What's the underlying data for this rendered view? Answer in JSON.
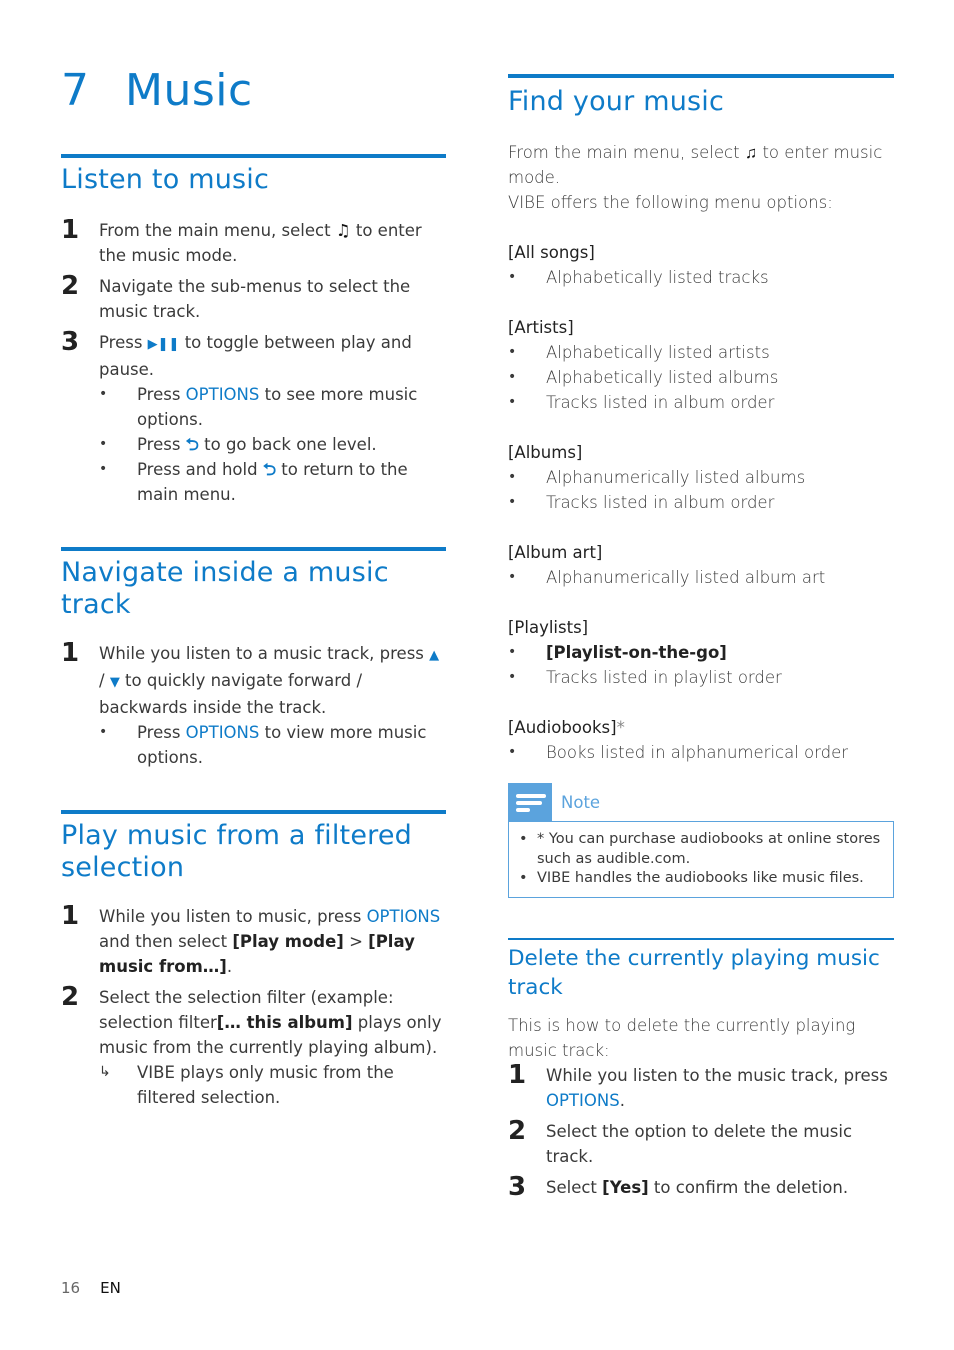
{
  "chapter": {
    "number": "7",
    "title": "Music"
  },
  "listen": {
    "title": "Listen to music",
    "steps": [
      {
        "n": "1",
        "before": "From the main menu, select ",
        "icon": "music-note-icon",
        "glyph": "♫",
        "after": " to enter the music mode."
      },
      {
        "n": "2",
        "text": "Navigate the sub-menus to select the music track."
      },
      {
        "n": "3",
        "before": "Press ",
        "icon": "play-pause-icon",
        "glyph": "▶❚❚",
        "after": " to toggle between play and pause."
      }
    ],
    "bullets": [
      {
        "before": "Press ",
        "highlight": "OPTIONS",
        "after": " to see more music options."
      },
      {
        "before": "Press ",
        "glyph": "⮌",
        "after": " to go back one level."
      },
      {
        "before": "Press and hold ",
        "glyph": "⮌",
        "after": " to return to the main menu."
      }
    ]
  },
  "navigate": {
    "title": "Navigate inside a music track",
    "step_n": "1",
    "step_before": "While you listen to a music track, press ",
    "up_glyph": "▲",
    "slash": " / ",
    "down_glyph": "▼",
    "step_after": " to quickly navigate forward / backwards inside the track.",
    "bullet": {
      "before": "Press ",
      "highlight": "OPTIONS",
      "after": " to view more music options."
    }
  },
  "filtered": {
    "title": "Play music from a filtered selection",
    "step1": {
      "n": "1",
      "a": "While you listen to music, press ",
      "opt": "OPTIONS",
      "b": " and then select ",
      "bold1": "[Play mode]",
      "c": " > ",
      "bold2": "[Play music from…]",
      "d": "."
    },
    "step2": {
      "n": "2",
      "a": "Select the selection filter (example: selection filter",
      "bold": "[… this album]",
      "b": " plays only music from the currently playing album)."
    },
    "result": {
      "arrow": "↳",
      "text": "VIBE plays only music from the filtered selection."
    }
  },
  "find": {
    "title": "Find your music",
    "intro_before": "From the main menu, select ",
    "intro_glyph": "♫",
    "intro_after": " to enter music mode.",
    "intro2": "VIBE offers the following menu options:",
    "groups": [
      {
        "header": "[All songs]",
        "items": [
          "Alphabetically listed tracks"
        ]
      },
      {
        "header": "[Artists]",
        "items": [
          "Alphabetically listed artists",
          "Alphabetically listed albums",
          "Tracks listed in album order"
        ]
      },
      {
        "header": "[Albums]",
        "items": [
          "Alphanumerically listed albums",
          "Tracks listed in album order"
        ]
      },
      {
        "header": "[Album art]",
        "items": [
          "Alphanumerically listed album art"
        ]
      },
      {
        "header": "[Playlists]",
        "items": [
          "[Playlist-on-the-go]",
          "Tracks listed in playlist order"
        ]
      },
      {
        "header": "[Audiobooks]",
        "suffix": "*",
        "items": [
          "Books listed in alphanumerical order"
        ]
      }
    ]
  },
  "note": {
    "label": "Note",
    "items": [
      "* You can purchase audiobooks at online stores such as audible.com.",
      "VIBE handles the audiobooks like music files."
    ]
  },
  "delete": {
    "title": "Delete the currently playing music track",
    "intro": "This is how to delete the currently playing music track:",
    "step1": {
      "n": "1",
      "a": "While you listen to the music track, press ",
      "opt": "OPTIONS",
      "b": "."
    },
    "step2": {
      "n": "2",
      "text": "Select the option to delete the music track."
    },
    "step3": {
      "n": "3",
      "a": "Select ",
      "bold": "[Yes]",
      "b": " to confirm the deletion."
    }
  },
  "footer": {
    "page": "16",
    "lang": "EN"
  },
  "colors": {
    "accent": "#0e7bc8",
    "note": "#5ba3dd"
  }
}
